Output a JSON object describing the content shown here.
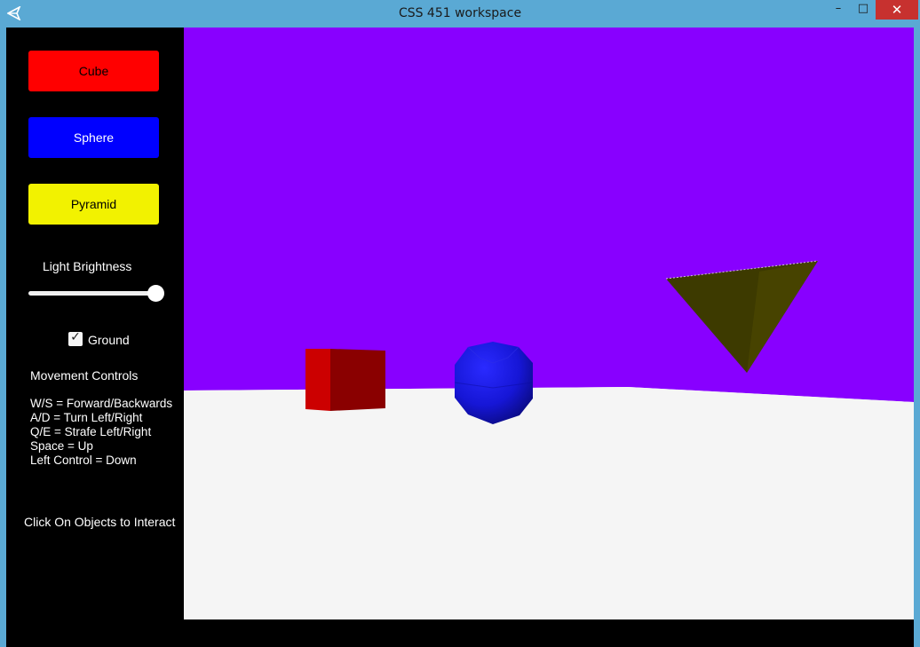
{
  "window": {
    "title": "CSS 451 workspace",
    "controls": {
      "minimize": "–",
      "maximize": "□",
      "close": "✕"
    },
    "app_icon": "unity-icon"
  },
  "panel": {
    "buttons": {
      "cube": "Cube",
      "sphere": "Sphere",
      "pyramid": "Pyramid"
    },
    "brightness": {
      "label": "Light Brightness",
      "value": 1.0
    },
    "ground": {
      "label": "Ground",
      "checked": true,
      "check_glyph": "✓"
    },
    "movement": {
      "title": "Movement Controls",
      "lines": [
        "W/S = Forward/Backwards",
        "A/D = Turn Left/Right",
        "Q/E = Strafe Left/Right",
        "Space = Up",
        "Left Control = Down"
      ]
    },
    "hint": "Click On Objects to Interact"
  },
  "colors": {
    "sky": "#8800ff",
    "ground": "#f5f5f5",
    "cube_btn": "#ff0000",
    "sphere_btn": "#0000ff",
    "pyramid_btn": "#f2f200",
    "cube": "#cc0000",
    "sphere": "#1a1adf",
    "pyramid": "#3d3a00"
  }
}
